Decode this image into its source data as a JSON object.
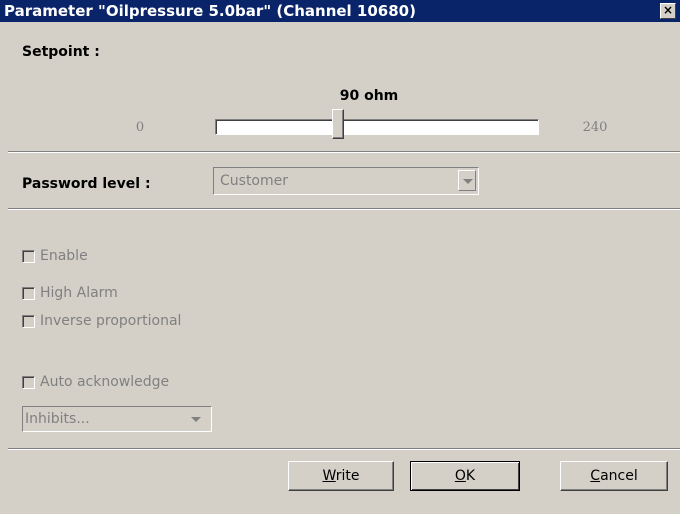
{
  "window": {
    "title": "Parameter \"Oilpressure 5.0bar\" (Channel 10680)",
    "close_glyph": "×"
  },
  "setpoint": {
    "label": "Setpoint :",
    "value_text": "90 ohm",
    "min_text": "0",
    "max_text": "240",
    "value": 90,
    "min": 0,
    "max": 240
  },
  "password": {
    "label": "Password level :",
    "selected": "Customer"
  },
  "checkboxes": {
    "enable": "Enable",
    "high_alarm": "High Alarm",
    "inverse": "Inverse proportional",
    "auto_ack": "Auto acknowledge"
  },
  "inhibits": {
    "selected": "Inhibits..."
  },
  "buttons": {
    "write_mn": "W",
    "write_rest": "rite",
    "ok_mn": "O",
    "ok_rest": "K",
    "cancel_mn": "C",
    "cancel_rest": "ancel"
  },
  "colors": {
    "titlebar": "#0a246a",
    "face": "#d4d0c8",
    "disabled_text": "#808080"
  }
}
